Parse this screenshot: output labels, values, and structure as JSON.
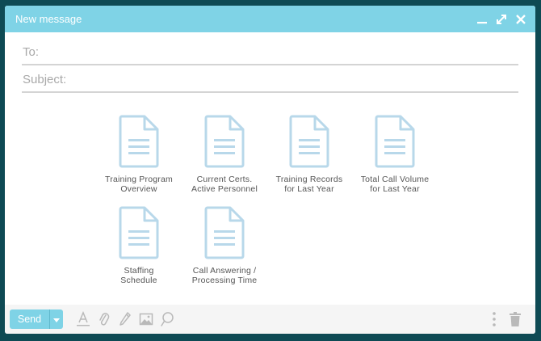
{
  "window": {
    "title": "New message",
    "controls": [
      "minimize-icon",
      "expand-icon",
      "close-icon"
    ]
  },
  "fields": {
    "to": {
      "label": "To:",
      "value": ""
    },
    "subject": {
      "label": "Subject:",
      "value": ""
    }
  },
  "attachments": [
    {
      "label": "Training Program\nOverview",
      "icon": "document-icon"
    },
    {
      "label": "Current Certs.\nActive Personnel",
      "icon": "document-icon"
    },
    {
      "label": "Training Records\nfor Last Year",
      "icon": "document-icon"
    },
    {
      "label": "Total Call Volume\nfor Last Year",
      "icon": "document-icon"
    },
    {
      "label": "Staffing\nSchedule",
      "icon": "document-icon"
    },
    {
      "label": "Call Answering /\nProcessing Time",
      "icon": "document-icon"
    }
  ],
  "toolbar": {
    "send_label": "Send",
    "tools": [
      "text-format-icon",
      "attach-icon",
      "pen-icon",
      "image-icon",
      "emoji-icon"
    ],
    "right_tools": [
      "more-options-icon",
      "trash-icon"
    ]
  },
  "colors": {
    "accent": "#7fd3e6",
    "background": "#0e4a54",
    "icon": "#b8d8ea"
  }
}
